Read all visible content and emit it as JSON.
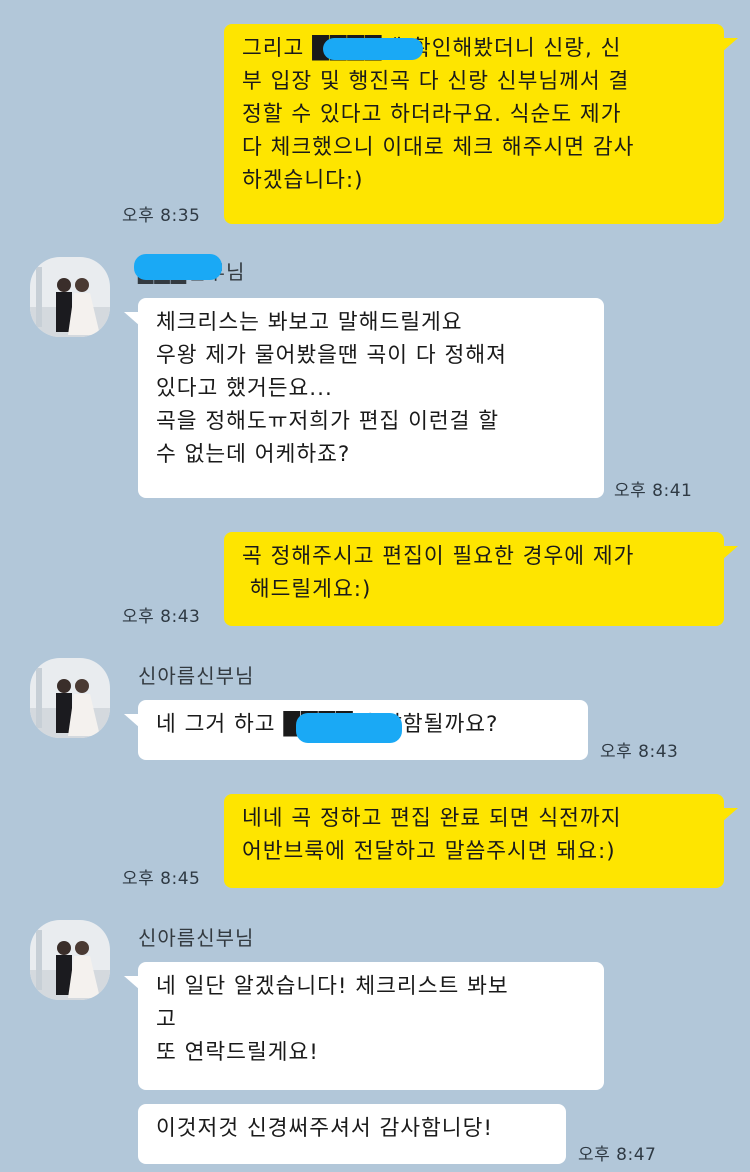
{
  "messages": [
    {
      "text": "그리고 ████에 확인해봤더니 신랑, 신\n부 입장 및 행진곡 다 신랑 신부님께서 결\n정할 수 있다고 하더라구요. 식순도 제가\n다 체크했으니 이대로 체크 해주시면 감사\n하겠습니다:)",
      "time": "오후 8:35"
    },
    {
      "sender": "███신부님",
      "text": "체크리스는 봐보고 말해드릴게요\n우왕 제가 물어봤을땐 곡이 다 정해져\n있다고 했거든요...\n곡을 정해도ㅠ저희가 편집 이런걸 할\n수 없는데 어케하죠?",
      "time": "오후 8:41"
    },
    {
      "text": "곡 정해주시고 편집이 필요한 경우에 제가\n 해드릴게요:)",
      "time": "오후 8:43"
    },
    {
      "sender": "신아름신부님",
      "text": "네 그거 하고 ████에 말함될까요?",
      "time": "오후 8:43"
    },
    {
      "text": "네네 곡 정하고 편집 완료 되면 식전까지\n어반브룩에 전달하고 말씀주시면 돼요:)",
      "time": "오후 8:45"
    },
    {
      "sender": "신아름신부님",
      "text": "네 일단 알겠습니다! 체크리스트 봐보\n고\n또 연락드릴게요!"
    },
    {
      "text": "이것저것 신경써주셔서 감사함니당!",
      "time": "오후 8:47"
    }
  ],
  "colors": {
    "background": "#b2c7d9",
    "my_bubble": "#fee500",
    "other_bubble": "#ffffff",
    "redaction": "#1aa9f5"
  }
}
